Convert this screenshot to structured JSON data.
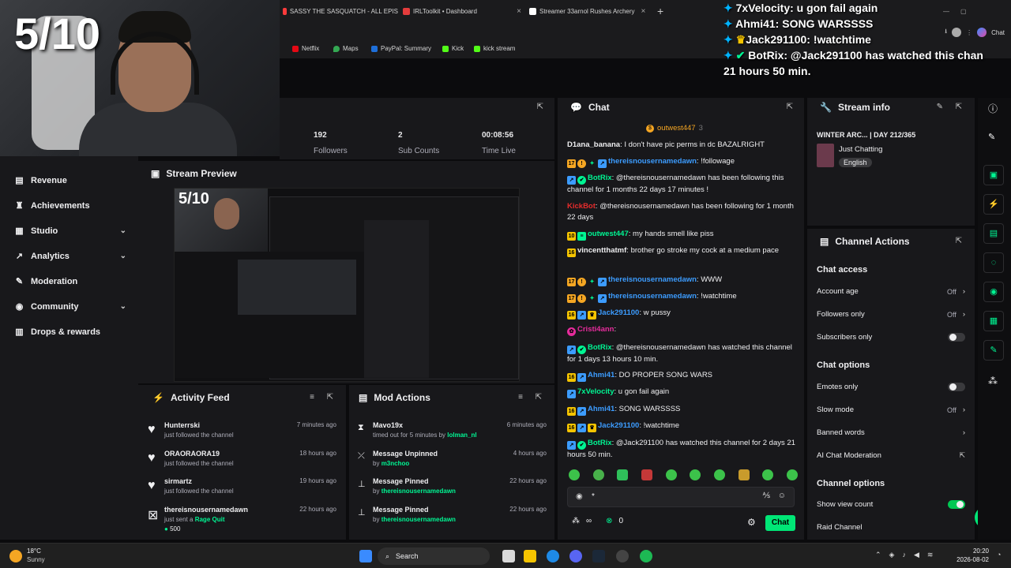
{
  "browser": {
    "tabs": [
      {
        "label": "SASSY THE SASQUATCH - ALL EPIS",
        "color": "#ff3b3b"
      },
      {
        "label": "IRLToolkit • Dashboard",
        "color": "#e43c3c"
      },
      {
        "label": "Streamer 33arnol Rushes Archery",
        "color": "#ffffff"
      }
    ],
    "new_tab": "+",
    "chat_label": "Chat",
    "bookmarks": [
      {
        "label": "Netflix",
        "color": "#e50914"
      },
      {
        "label": "Maps",
        "color": "#34a853"
      },
      {
        "label": "PayPal: Summary",
        "color": "#1e6fd9"
      },
      {
        "label": "Kick",
        "color": "#53fc18"
      },
      {
        "label": "kick stream",
        "color": "#53fc18"
      }
    ]
  },
  "webcam": {
    "score": "5/10"
  },
  "overlay_chat": [
    {
      "user": "7xVelocity:",
      "text": "u gon fail again"
    },
    {
      "user": "Ahmi41:",
      "text": "SONG WARSSSS"
    },
    {
      "user": "Jack291100:",
      "text": "!watchtime"
    },
    {
      "user": "BotRix:",
      "text": "@Jack291100 has watched this chan"
    },
    {
      "user": "",
      "text": "21 hours 50 min."
    }
  ],
  "sidebar": {
    "items": [
      {
        "label": "Revenue",
        "icon": "revenue-icon",
        "glyph": "▤",
        "chevron": false
      },
      {
        "label": "Achievements",
        "icon": "trophy-icon",
        "glyph": "🏆",
        "chevron": false
      },
      {
        "label": "Studio",
        "icon": "studio-icon",
        "glyph": "▦",
        "chevron": true
      },
      {
        "label": "Analytics",
        "icon": "analytics-icon",
        "glyph": "↗",
        "chevron": true
      },
      {
        "label": "Moderation",
        "icon": "wrench-icon",
        "glyph": "🔧",
        "chevron": false
      },
      {
        "label": "Community",
        "icon": "community-icon",
        "glyph": "◉",
        "chevron": true
      },
      {
        "label": "Drops & rewards",
        "icon": "gift-icon",
        "glyph": "▥",
        "chevron": false
      }
    ]
  },
  "stats": {
    "followers_value": "192",
    "followers_label": "Followers",
    "subs_value": "2",
    "subs_label": "Sub Counts",
    "time_value": "00:08:56",
    "time_label": "Time Live"
  },
  "preview": {
    "title": "Stream Preview",
    "score": "5/10"
  },
  "activity": {
    "title": "Activity Feed",
    "items": [
      {
        "name": "Hunterrski",
        "desc": "just followed the channel",
        "time": "7 minutes ago"
      },
      {
        "name": "ORAORAORA19",
        "desc": "just followed the channel",
        "time": "18 hours ago"
      },
      {
        "name": "sirmartz",
        "desc": "just followed the channel",
        "time": "19 hours ago"
      },
      {
        "name": "thereisnousernamedawn",
        "desc": "just sent a",
        "gift": "Rage Quit",
        "amount": "500",
        "time": "22 hours ago"
      }
    ]
  },
  "mod_actions": {
    "title": "Mod Actions",
    "items": [
      {
        "title": "Mavo19x",
        "desc": "timed out for 5 minutes by",
        "by": "lolman_nl",
        "time": "6 minutes ago"
      },
      {
        "title": "Message Unpinned",
        "desc": "by",
        "by": "m3nchoo",
        "time": "4 hours ago"
      },
      {
        "title": "Message Pinned",
        "desc": "by",
        "by": "thereisnousernamedawn",
        "time": "22 hours ago"
      },
      {
        "title": "Message Pinned",
        "desc": "by",
        "by": "thereisnousernamedawn",
        "time": "22 hours ago"
      }
    ]
  },
  "chat": {
    "title": "Chat",
    "pinned_user": "outwest447",
    "pinned_count": "3",
    "messages": [
      {
        "user": "D1ana_banana",
        "color": "#efeff1",
        "text": "I don't have pic perms in dc BAZALRIGHT"
      },
      {
        "user": "thereisnousernamedawn",
        "color": "#3c9cff",
        "text": "!followage",
        "badge": "17"
      },
      {
        "user": "BotRix",
        "color": "#00f593",
        "text": "@thereisnousernamedawn has been following this channel for 1 months 22 days 17 minutes !"
      },
      {
        "user": "KickBot",
        "color": "#e62c2c",
        "text": "@thereisnousernamedawn has been following for 1 month 22 days"
      },
      {
        "user": "outwest447",
        "color": "#00f593",
        "text": "my hands smell like piss",
        "badge": "10"
      },
      {
        "user": "vincentthatmf",
        "color": "#efeff1",
        "text": "brother go stroke my cock at a medium pace",
        "badge": "16"
      },
      {
        "user": "thereisnousernamedawn",
        "color": "#3c9cff",
        "text": "WWW",
        "badge": "17"
      },
      {
        "user": "thereisnousernamedawn",
        "color": "#3c9cff",
        "text": "!watchtime",
        "badge": "17"
      },
      {
        "user": "Jack291100",
        "color": "#3c9cff",
        "text": "w pussy",
        "badge": "16"
      },
      {
        "user": "Cristi4ann",
        "color": "#e62c9c",
        "text": ""
      },
      {
        "user": "BotRix",
        "color": "#00f593",
        "text": "@thereisnousernamedawn has watched this channel for 1 days 13 hours 10 min."
      },
      {
        "user": "Ahmi41",
        "color": "#3c9cff",
        "text": "DO PROPER SONG WARS",
        "badge": "16"
      },
      {
        "user": "7xVelocity",
        "color": "#00f593",
        "text": "u gon fail again"
      },
      {
        "user": "Ahmi41",
        "color": "#3c9cff",
        "text": "SONG WARSSSS",
        "badge": "16"
      },
      {
        "user": "Jack291100",
        "color": "#3c9cff",
        "text": "!watchtime",
        "badge": "16"
      },
      {
        "user": "BotRix",
        "color": "#00f593",
        "text": "@Jack291100 has watched this channel for 2 days 21 hours 50 min."
      }
    ],
    "input_value": "*",
    "viewers": "0",
    "send_label": "Chat"
  },
  "stream_info": {
    "title": "Stream info",
    "stream_title": "WINTER ARC... | DAY 212/365",
    "category": "Just Chatting",
    "language": "English"
  },
  "channel_actions": {
    "title": "Channel Actions",
    "chat_access": "Chat access",
    "account_age": "Account age",
    "account_age_val": "Off",
    "followers_only": "Followers only",
    "followers_only_val": "Off",
    "subscribers_only": "Subscribers only",
    "chat_options": "Chat options",
    "emotes_only": "Emotes only",
    "slow_mode": "Slow mode",
    "slow_mode_val": "Off",
    "banned_words": "Banned words",
    "ai_moderation": "AI Chat Moderation",
    "channel_options": "Channel options",
    "show_view_count": "Show view count",
    "raid_channel": "Raid Channel"
  },
  "taskbar": {
    "temp": "18°C",
    "weather": "Sunny",
    "search": "Search",
    "time": "20:20",
    "date": "2026-08-02"
  },
  "colors": {
    "accent": "#00f593",
    "panel": "#18181b",
    "bg": "#0b0b0d"
  }
}
